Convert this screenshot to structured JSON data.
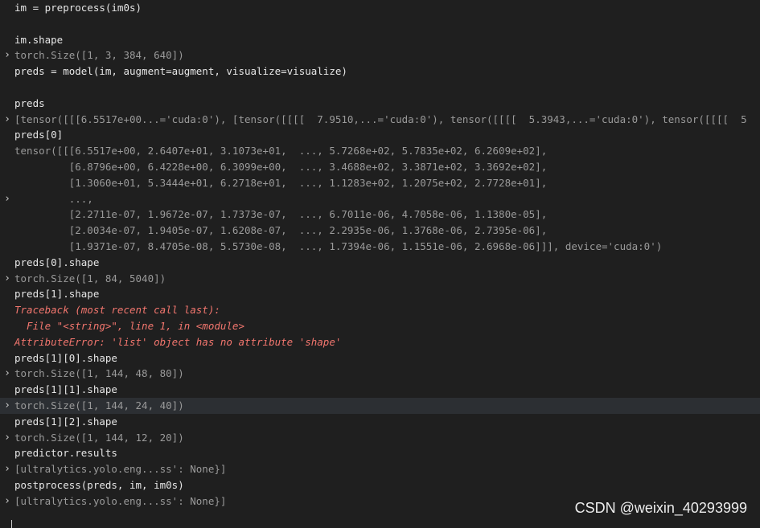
{
  "console": {
    "lines": [
      {
        "kind": "in",
        "chevron": false,
        "text": "im = preprocess(im0s)"
      },
      {
        "kind": "blank",
        "chevron": false,
        "text": ""
      },
      {
        "kind": "in",
        "chevron": false,
        "text": "im.shape"
      },
      {
        "kind": "out",
        "chevron": true,
        "text": "torch.Size([1, 3, 384, 640])"
      },
      {
        "kind": "in",
        "chevron": false,
        "text": "preds = model(im, augment=augment, visualize=visualize)"
      },
      {
        "kind": "blank",
        "chevron": false,
        "text": ""
      },
      {
        "kind": "in",
        "chevron": false,
        "text": "preds"
      },
      {
        "kind": "out",
        "chevron": true,
        "text": "[tensor([[[6.5517e+00...='cuda:0'), [tensor([[[[  7.9510,...='cuda:0'), tensor([[[[  5.3943,...='cuda:0'), tensor([[[[  5"
      },
      {
        "kind": "in",
        "chevron": false,
        "text": "preds[0]"
      },
      {
        "kind": "out",
        "chevron": false,
        "text": "tensor([[[6.5517e+00, 2.6407e+01, 3.1073e+01,  ..., 5.7268e+02, 5.7835e+02, 6.2609e+02],"
      },
      {
        "kind": "out",
        "chevron": false,
        "text": "         [6.8796e+00, 6.4228e+00, 6.3099e+00,  ..., 3.4688e+02, 3.3871e+02, 3.3692e+02],"
      },
      {
        "kind": "out",
        "chevron": false,
        "text": "         [1.3060e+01, 5.3444e+01, 6.2718e+01,  ..., 1.1283e+02, 1.2075e+02, 2.7728e+01],"
      },
      {
        "kind": "out",
        "chevron": true,
        "text": "         ...,"
      },
      {
        "kind": "out",
        "chevron": false,
        "text": "         [2.2711e-07, 1.9672e-07, 1.7373e-07,  ..., 6.7011e-06, 4.7058e-06, 1.1380e-05],"
      },
      {
        "kind": "out",
        "chevron": false,
        "text": "         [2.0034e-07, 1.9405e-07, 1.6208e-07,  ..., 2.2935e-06, 1.3768e-06, 2.7395e-06],"
      },
      {
        "kind": "out",
        "chevron": false,
        "text": "         [1.9371e-07, 8.4705e-08, 5.5730e-08,  ..., 1.7394e-06, 1.1551e-06, 2.6968e-06]]], device='cuda:0')"
      },
      {
        "kind": "in",
        "chevron": false,
        "text": "preds[0].shape"
      },
      {
        "kind": "out",
        "chevron": true,
        "text": "torch.Size([1, 84, 5040])"
      },
      {
        "kind": "in",
        "chevron": false,
        "text": "preds[1].shape"
      },
      {
        "kind": "err",
        "chevron": false,
        "text": "Traceback (most recent call last):"
      },
      {
        "kind": "err",
        "chevron": false,
        "text": "  File \"<string>\", line 1, in <module>"
      },
      {
        "kind": "err",
        "chevron": false,
        "text": "AttributeError: 'list' object has no attribute 'shape'"
      },
      {
        "kind": "in",
        "chevron": false,
        "text": "preds[1][0].shape"
      },
      {
        "kind": "out",
        "chevron": true,
        "text": "torch.Size([1, 144, 48, 80])"
      },
      {
        "kind": "in",
        "chevron": false,
        "text": "preds[1][1].shape"
      },
      {
        "kind": "out",
        "chevron": true,
        "text": "torch.Size([1, 144, 24, 40])",
        "highlight": true
      },
      {
        "kind": "in",
        "chevron": false,
        "text": "preds[1][2].shape"
      },
      {
        "kind": "out",
        "chevron": true,
        "text": "torch.Size([1, 144, 12, 20])"
      },
      {
        "kind": "in",
        "chevron": false,
        "text": "predictor.results"
      },
      {
        "kind": "out",
        "chevron": true,
        "text": "[ultralytics.yolo.eng...ss': None}]"
      },
      {
        "kind": "in",
        "chevron": false,
        "text": "postprocess(preds, im, im0s)"
      },
      {
        "kind": "out",
        "chevron": true,
        "text": "[ultralytics.yolo.eng...ss': None}]"
      }
    ],
    "chevron_glyph": "›"
  },
  "watermark": {
    "text": "CSDN @weixin_40293999"
  }
}
